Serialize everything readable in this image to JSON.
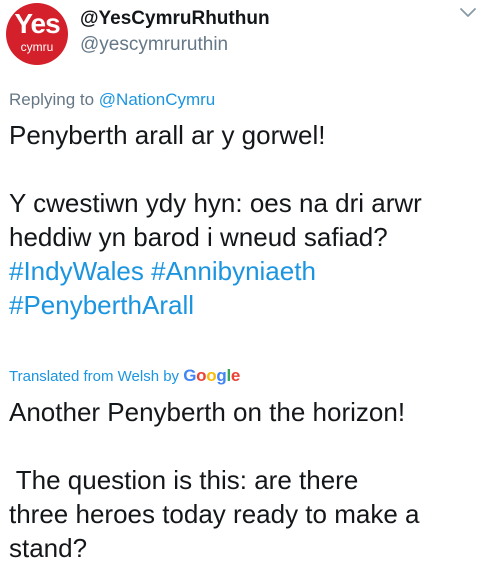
{
  "header": {
    "avatar": {
      "top_text": "Yes",
      "bottom_text": "cymru",
      "color": "#d4202a"
    },
    "display_name": "@YesCymruRhuthun",
    "handle": "@yescymruruthin",
    "menu_icon": "chevron-down-icon"
  },
  "reply": {
    "prefix": "Replying to",
    "mention": "@NationCymru"
  },
  "tweet": {
    "line1": "Penyberth arall ar y gorwel!",
    "line2": "Y cwestiwn ydy hyn: oes na dri arwr",
    "line3": "heddiw yn barod i wneud safiad?",
    "hashtags_line1": [
      "#IndyWales",
      "#Annibyniaeth"
    ],
    "hashtags_line2": [
      "#PenyberthArall"
    ]
  },
  "translation_label": {
    "text": "Translated from Welsh by",
    "provider": [
      "G",
      "o",
      "o",
      "g",
      "l",
      "e"
    ],
    "provider_colors": [
      "#4285f4",
      "#ea4335",
      "#fbbc05",
      "#4285f4",
      "#34a853",
      "#ea4335"
    ]
  },
  "translation": {
    "line1": "Another Penyberth on the horizon!",
    "line2": " The question is this: are there",
    "line3": "three heroes today ready to make a",
    "line4": "stand?"
  },
  "colors": {
    "link": "#1b95e0",
    "secondary": "#657786",
    "text": "#14171a"
  }
}
